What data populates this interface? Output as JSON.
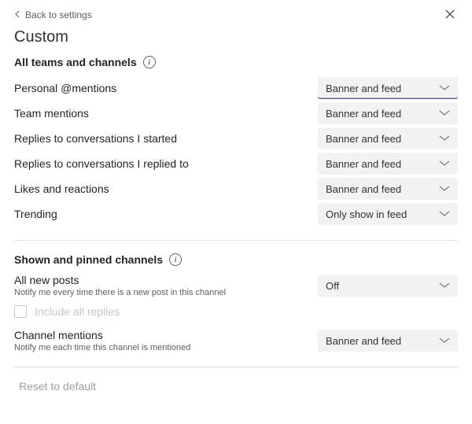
{
  "nav": {
    "back_label": "Back to settings"
  },
  "page_title": "Custom",
  "section_all": {
    "title": "All teams and channels",
    "rows": [
      {
        "label": "Personal @mentions",
        "value": "Banner and feed",
        "active": true
      },
      {
        "label": "Team mentions",
        "value": "Banner and feed",
        "active": false
      },
      {
        "label": "Replies to conversations I started",
        "value": "Banner and feed",
        "active": false
      },
      {
        "label": "Replies to conversations I replied to",
        "value": "Banner and feed",
        "active": false
      },
      {
        "label": "Likes and reactions",
        "value": "Banner and feed",
        "active": false
      },
      {
        "label": "Trending",
        "value": "Only show in feed",
        "active": false
      }
    ]
  },
  "section_pinned": {
    "title": "Shown and pinned channels",
    "all_new_posts": {
      "label": "All new posts",
      "sub": "Notify me every time there is a new post in this channel",
      "value": "Off"
    },
    "include_all_replies": "Include all replies",
    "channel_mentions": {
      "label": "Channel mentions",
      "sub": "Notify me each time this channel is mentioned",
      "value": "Banner and feed"
    }
  },
  "reset_label": "Reset to default"
}
